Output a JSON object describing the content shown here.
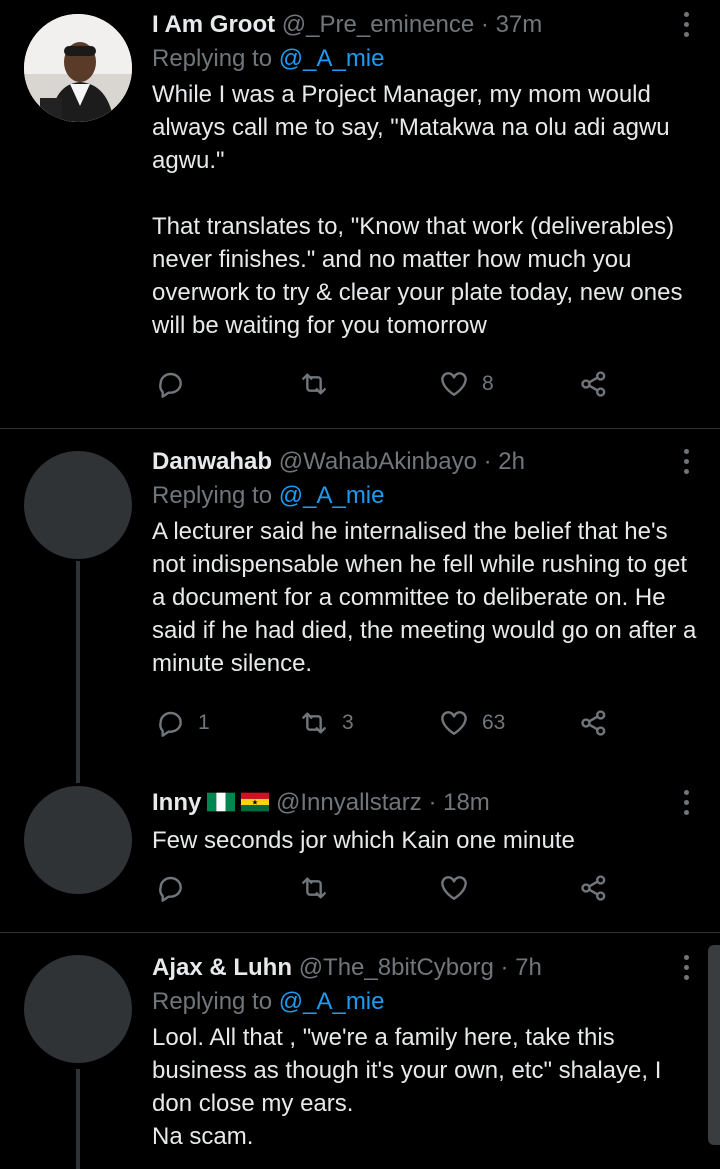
{
  "tweets": [
    {
      "name": "I Am Groot",
      "handle": "@_Pre_eminence",
      "time": "· 37m",
      "replying_prefix": "Replying to ",
      "replying_to": "@_A_mie",
      "text": "While I was a Project Manager, my mom would always call me to say, \"Matakwa na olu adi agwu agwu.\"\n\nThat translates to, \"Know that work (deliverables) never finishes.\" and no matter how much you overwork to try & clear your plate today, new ones will be waiting for you tomorrow",
      "replies": "",
      "retweets": "",
      "likes": "8"
    },
    {
      "name": "Danwahab",
      "handle": "@WahabAkinbayo",
      "time": "· 2h",
      "replying_prefix": "Replying to ",
      "replying_to": "@_A_mie",
      "text": "A lecturer said he internalised the belief that he's not indispensable when he fell while rushing to get a document for a committee to deliberate on. He said if he had died, the meeting would go on after a minute silence.",
      "replies": "1",
      "retweets": "3",
      "likes": "63"
    },
    {
      "name": "Inny",
      "handle": "@Innyallstarz",
      "time": "· 18m",
      "text": "Few seconds jor which Kain one minute",
      "replies": "",
      "retweets": "",
      "likes": ""
    },
    {
      "name": "Ajax & Luhn",
      "handle": "@The_8bitCyborg",
      "time": "· 7h",
      "replying_prefix": "Replying to ",
      "replying_to": "@_A_mie",
      "text": "Lool. All that , \"we're a family here, take this business as though it's your own, etc\" shalaye, I don close my ears.\nNa scam."
    }
  ],
  "icons": {
    "reply": "reply-icon",
    "retweet": "retweet-icon",
    "like": "heart-icon",
    "share": "share-icon",
    "menu": "more-vertical-icon"
  },
  "colors": {
    "background": "#000000",
    "text": "#e7e9ea",
    "secondary": "#71767b",
    "link": "#1d9bf0",
    "divider": "#2f3336"
  }
}
